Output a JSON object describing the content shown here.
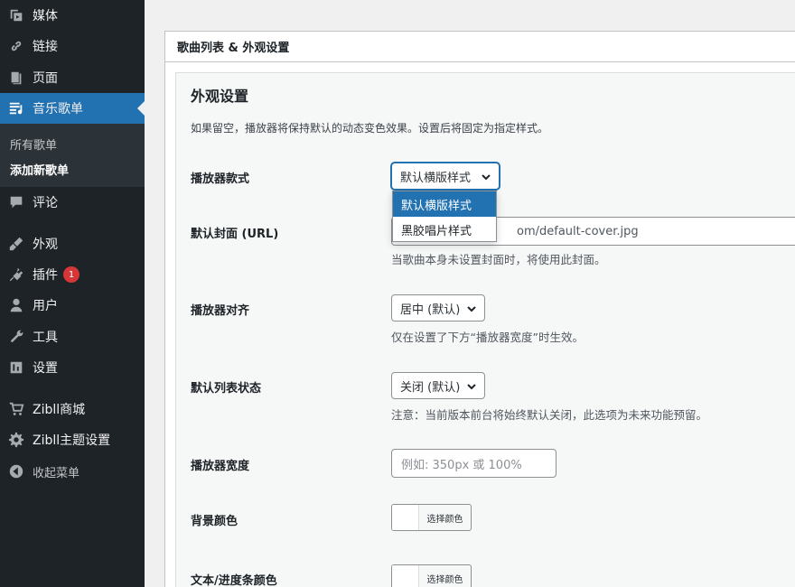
{
  "sidebar": {
    "items": [
      {
        "label": "媒体",
        "icon": "media-icon"
      },
      {
        "label": "链接",
        "icon": "link-icon"
      },
      {
        "label": "页面",
        "icon": "page-icon"
      },
      {
        "label": "音乐歌单",
        "icon": "playlist-icon"
      },
      {
        "label": "评论",
        "icon": "comment-icon"
      },
      {
        "label": "外观",
        "icon": "appearance-icon"
      },
      {
        "label": "插件",
        "icon": "plugin-icon",
        "badge": "1"
      },
      {
        "label": "用户",
        "icon": "user-icon"
      },
      {
        "label": "工具",
        "icon": "wrench-icon"
      },
      {
        "label": "设置",
        "icon": "settings-icon"
      },
      {
        "label": "Zibll商城",
        "icon": "cart-icon"
      },
      {
        "label": "Zibll主题设置",
        "icon": "gear-icon"
      }
    ],
    "submenu": [
      {
        "label": "所有歌单"
      },
      {
        "label": "添加新歌单"
      }
    ],
    "collapse_label": "收起菜单"
  },
  "postbox": {
    "title": "歌曲列表 & 外观设置"
  },
  "section": {
    "title": "外观设置",
    "description": "如果留空，播放器将保持默认的动态变色效果。设置后将固定为指定样式。"
  },
  "fields": {
    "player_style": {
      "label": "播放器款式",
      "value": "默认横版样式",
      "options": [
        "默认横版样式",
        "黑胶唱片样式"
      ]
    },
    "default_cover": {
      "label": "默认封面 (URL)",
      "value": "om/default-cover.jpg",
      "description": "当歌曲本身未设置封面时，将使用此封面。"
    },
    "player_align": {
      "label": "播放器对齐",
      "value": "居中 (默认)",
      "description": "仅在设置了下方“播放器宽度”时生效。"
    },
    "list_state": {
      "label": "默认列表状态",
      "value": "关闭 (默认)",
      "description": "注意：当前版本前台将始终默认关闭，此选项为未来功能预留。"
    },
    "player_width": {
      "label": "播放器宽度",
      "placeholder": "例如: 350px 或 100%"
    },
    "bg_color": {
      "label": "背景颜色",
      "button": "选择颜色"
    },
    "text_color": {
      "label": "文本/进度条颜色",
      "button": "选择颜色"
    }
  },
  "colors": {
    "sidebar_bg": "#1d2327",
    "accent": "#2271b1",
    "badge": "#d63638"
  }
}
